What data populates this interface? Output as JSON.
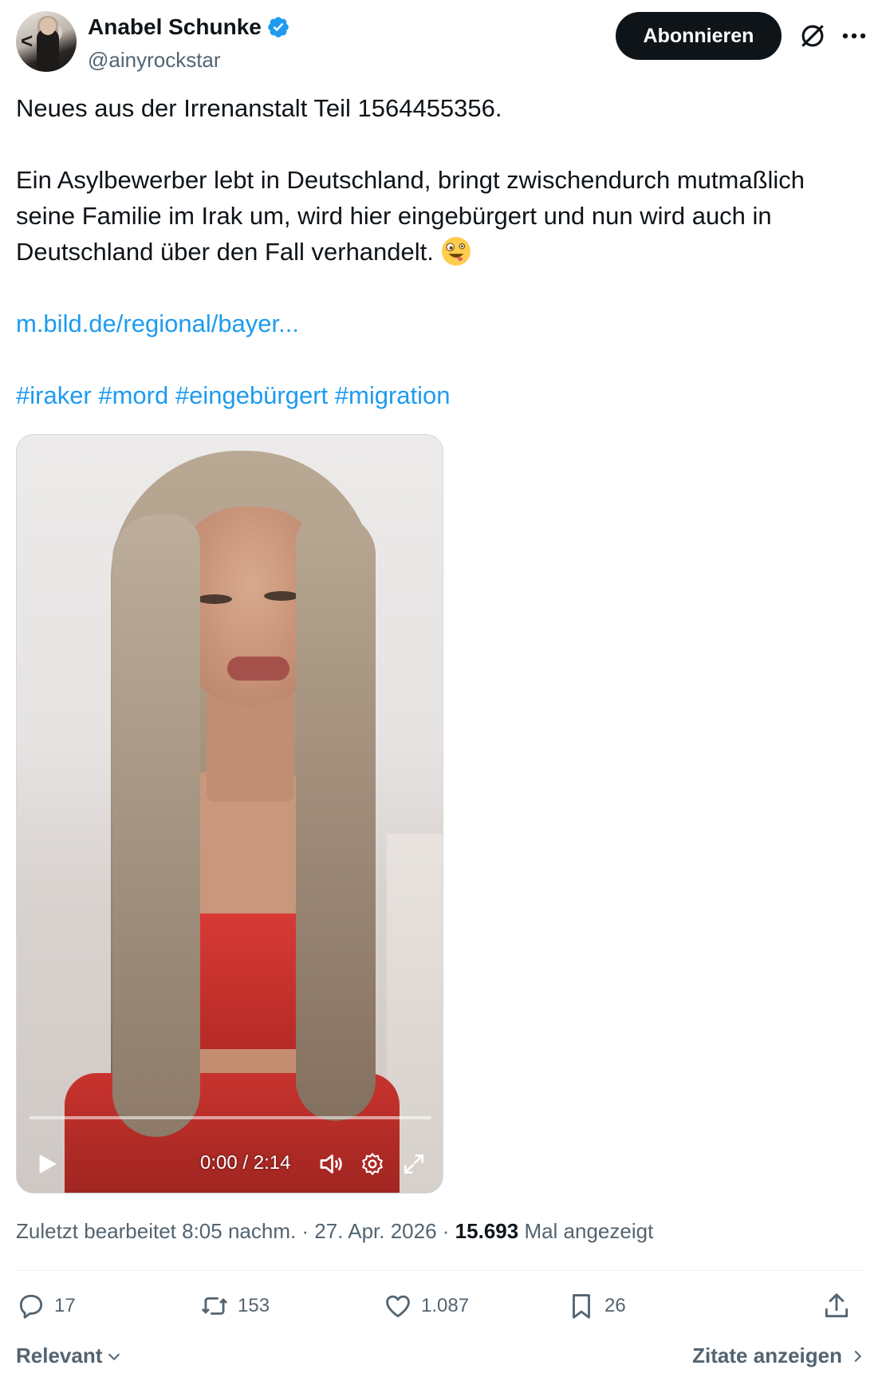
{
  "author": {
    "display_name": "Anabel Schunke",
    "handle": "@ainyrockstar",
    "verified": true
  },
  "header": {
    "subscribe_label": "Abonnieren"
  },
  "tweet": {
    "line1": "Neues aus der Irrenanstalt Teil 1564455356.",
    "line2": "Ein Asylbewerber lebt in Deutschland, bringt zwischendurch mutmaßlich seine Familie im Irak um, wird hier eingebürgert und nun wird auch in Deutschland über den Fall verhandelt.",
    "emoji": "zany-face",
    "link": "m.bild.de/regional/bayer...",
    "hashtags": "#iraker #mord #eingebürgert #migration"
  },
  "video": {
    "time": "0:00 / 2:14",
    "progress": 0
  },
  "meta": {
    "edited": "Zuletzt bearbeitet 8:05 nachm. · 27. Apr. 2026 · ",
    "views_count": "15.693",
    "views_label": "Mal angezeigt"
  },
  "actions": {
    "replies": "17",
    "reposts": "153",
    "likes": "1.087",
    "bookmarks": "26"
  },
  "footer": {
    "sort_label": "Relevant",
    "quotes_label": "Zitate anzeigen"
  },
  "colors": {
    "link": "#1d9bf0",
    "verified": "#1d9bf0",
    "text": "#0f1419",
    "secondary": "#536471"
  }
}
